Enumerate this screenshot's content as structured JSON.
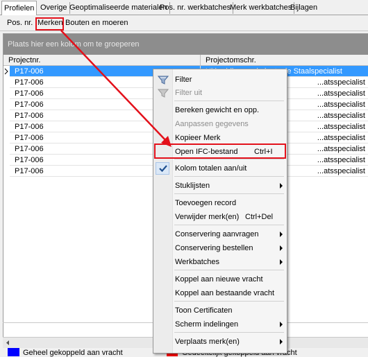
{
  "tabs": [
    "Profielen",
    "Overige",
    "Geoptimaliseerde materialen",
    "Pos. nr. werkbatches",
    "Merk werkbatches",
    "Bijlagen"
  ],
  "subtabs": [
    "Pos. nr.",
    "Merken",
    "Bouten en moeren"
  ],
  "grid": {
    "group_hint": "Plaats hier een kolom om te groeperen",
    "columns": [
      "Projectnr.",
      "Projectomschr."
    ],
    "rows": [
      [
        "P17-006",
        "Uitbreiding werkplaats de Staalspecialist"
      ],
      [
        "P17-006",
        "...atsspecialist"
      ],
      [
        "P17-006",
        "...atsspecialist"
      ],
      [
        "P17-006",
        "...atsspecialist"
      ],
      [
        "P17-006",
        "...atsspecialist"
      ],
      [
        "P17-006",
        "...atsspecialist"
      ],
      [
        "P17-006",
        "...atsspecialist"
      ],
      [
        "P17-006",
        "...atsspecialist"
      ],
      [
        "P17-006",
        "...atsspecialist"
      ],
      [
        "P17-006",
        "...atsspecialist"
      ]
    ]
  },
  "legend": {
    "left_label": "Geheel gekoppeld aan vracht",
    "right_label": "Gedeeltelijk gekoppeld aan vracht",
    "left_color": "#0000ff",
    "right_color": "#ff0000"
  },
  "menu": {
    "filter": "Filter",
    "filter_uit": "Filter uit",
    "bereken": "Bereken gewicht en opp.",
    "aanpassen": "Aanpassen gegevens",
    "kopieer": "Kopieer Merk",
    "open_ifc": "Open IFC-bestand",
    "open_ifc_shortcut": "Ctrl+I",
    "kolom_totalen": "Kolom totalen aan/uit",
    "stuklijsten": "Stuklijsten",
    "toevoegen": "Toevoegen record",
    "verwijder": "Verwijder merk(en)",
    "verwijder_shortcut": "Ctrl+Del",
    "conservering_aanvragen": "Conservering aanvragen",
    "conservering_bestellen": "Conservering bestellen",
    "werkbatches": "Werkbatches",
    "koppel_nieuwe": "Koppel aan nieuwe vracht",
    "koppel_bestaande": "Koppel aan bestaande vracht",
    "toon_certificaten": "Toon Certificaten",
    "scherm_indelingen": "Scherm indelingen",
    "verplaats": "Verplaats merk(en)"
  },
  "colors": {
    "selection": "#3399ff",
    "highlight": "#e3101a",
    "groupbar": "#8d8d8d"
  },
  "icons": [
    "filter-icon",
    "filter-off-icon",
    "checkmark-icon"
  ]
}
